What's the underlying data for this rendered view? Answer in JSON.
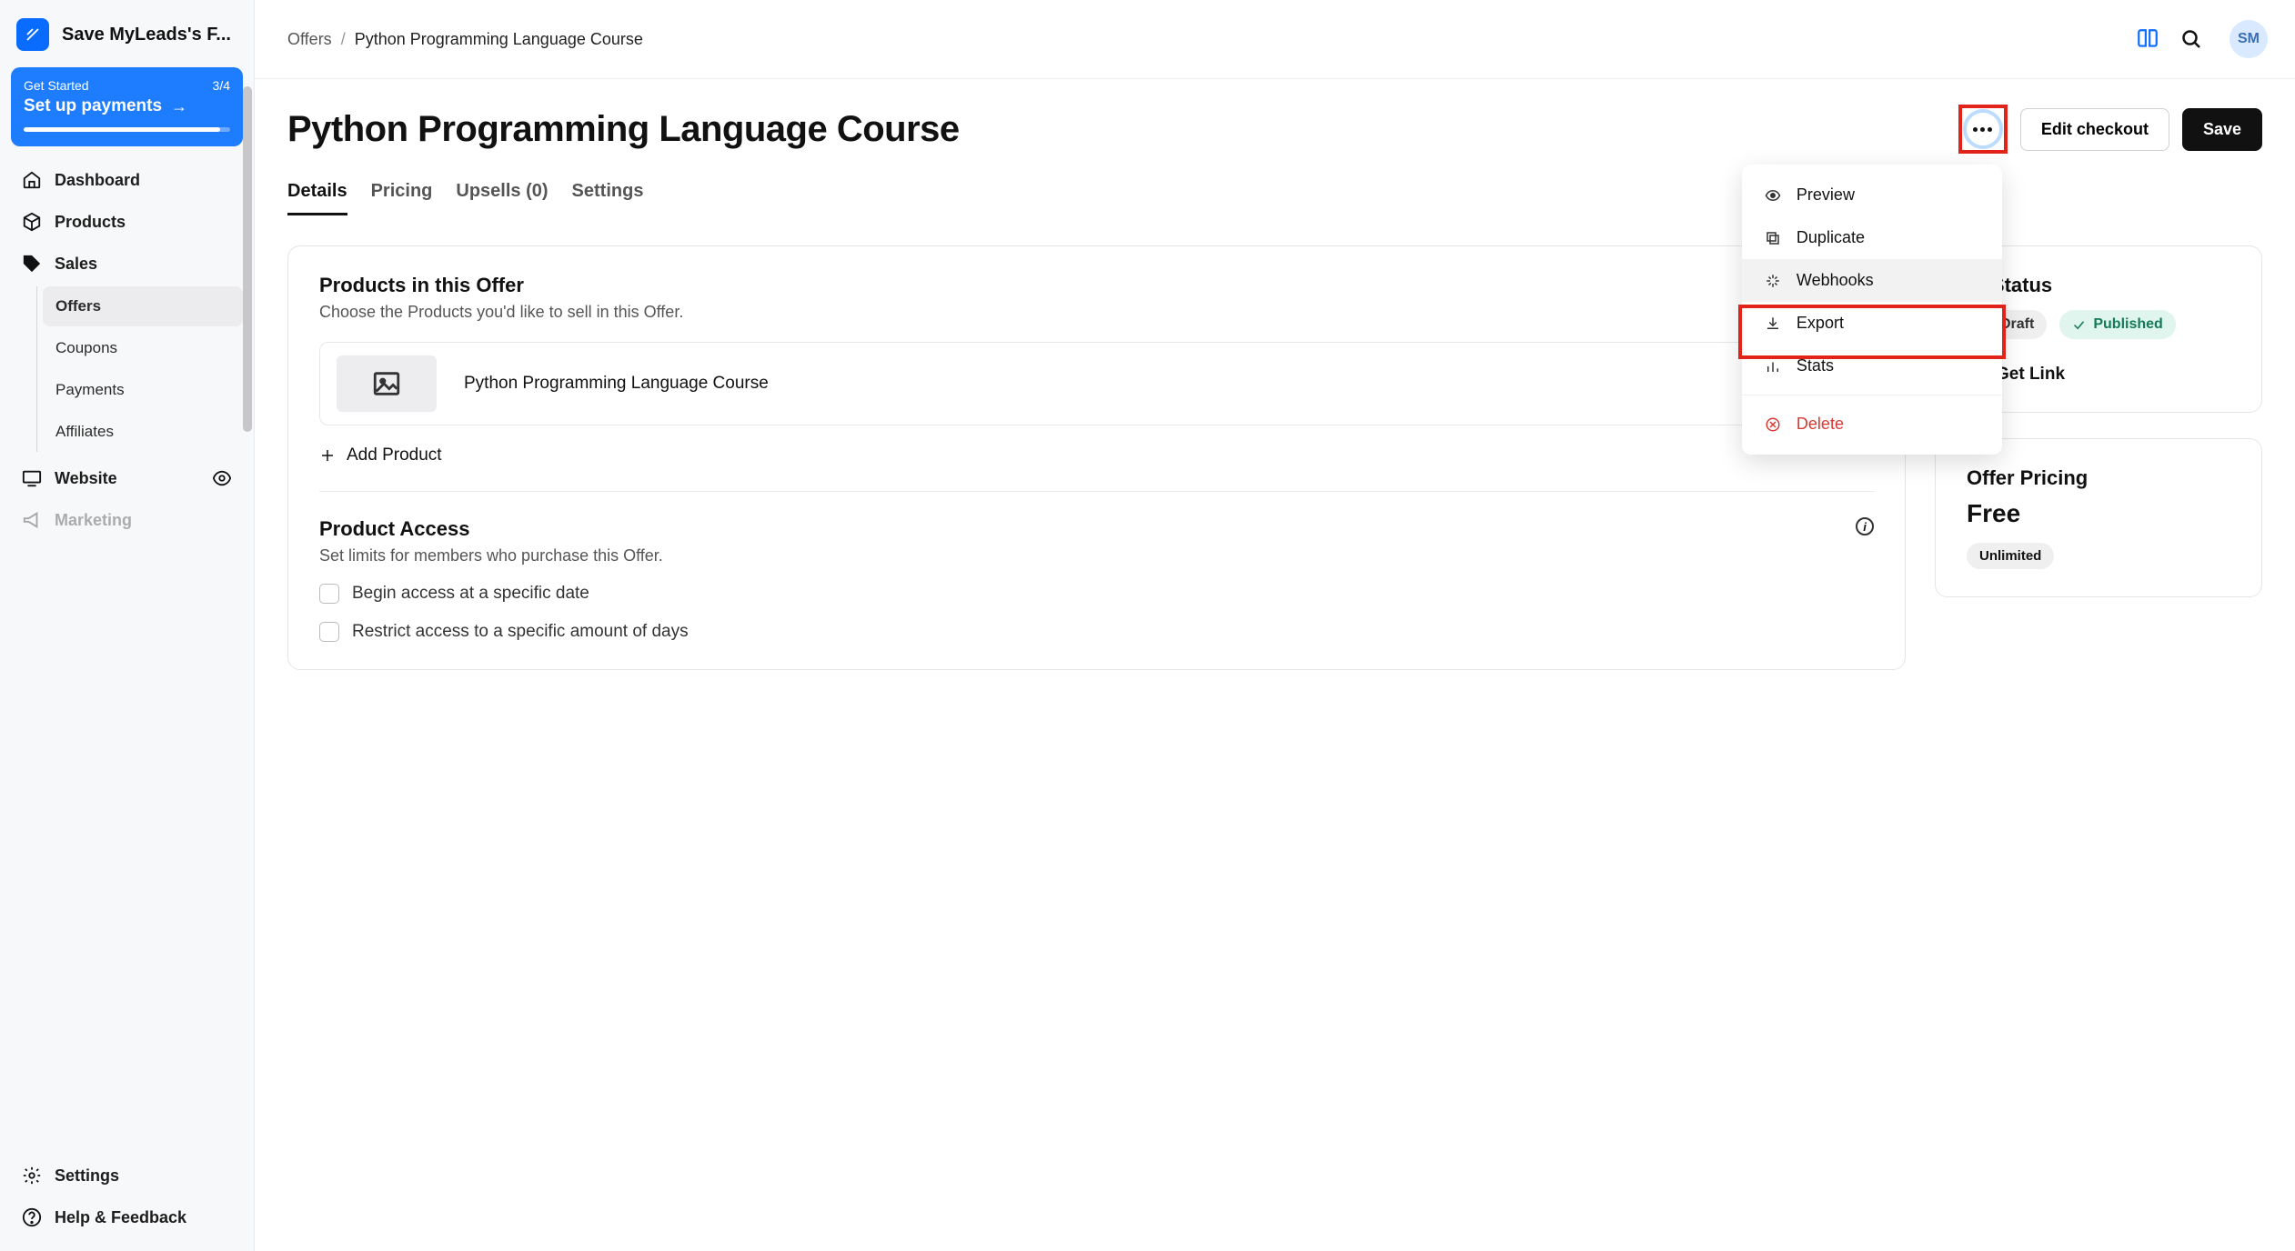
{
  "brand": {
    "name": "Save MyLeads's F..."
  },
  "get_started": {
    "label": "Get Started",
    "progress": "3/4",
    "action": "Set up payments"
  },
  "nav": {
    "dashboard": "Dashboard",
    "products": "Products",
    "sales": "Sales",
    "sales_items": {
      "offers": "Offers",
      "coupons": "Coupons",
      "payments": "Payments",
      "affiliates": "Affiliates"
    },
    "website": "Website",
    "marketing": "Marketing",
    "settings": "Settings",
    "help": "Help & Feedback"
  },
  "breadcrumb": {
    "root": "Offers",
    "current": "Python Programming Language Course"
  },
  "avatar": "SM",
  "page": {
    "title": "Python Programming Language Course",
    "edit_checkout": "Edit checkout",
    "save": "Save"
  },
  "tabs": {
    "details": "Details",
    "pricing": "Pricing",
    "upsells": "Upsells (0)",
    "settings": "Settings"
  },
  "dropdown": {
    "preview": "Preview",
    "duplicate": "Duplicate",
    "webhooks": "Webhooks",
    "export": "Export",
    "stats": "Stats",
    "delete": "Delete"
  },
  "products_section": {
    "title": "Products in this Offer",
    "sub": "Choose the Products you'd like to sell in this Offer.",
    "item": "Python Programming Language Course",
    "add": "Add Product"
  },
  "access_section": {
    "title": "Product Access",
    "sub": "Set limits for members who purchase this Offer.",
    "opt1": "Begin access at a specific date",
    "opt2": "Restrict access to a specific amount of days"
  },
  "status_panel": {
    "title_suffix": "er Status",
    "draft": "Draft",
    "published": "Published",
    "get_link": "Get Link"
  },
  "pricing_panel": {
    "title": "Offer Pricing",
    "price": "Free",
    "unlimited": "Unlimited"
  }
}
